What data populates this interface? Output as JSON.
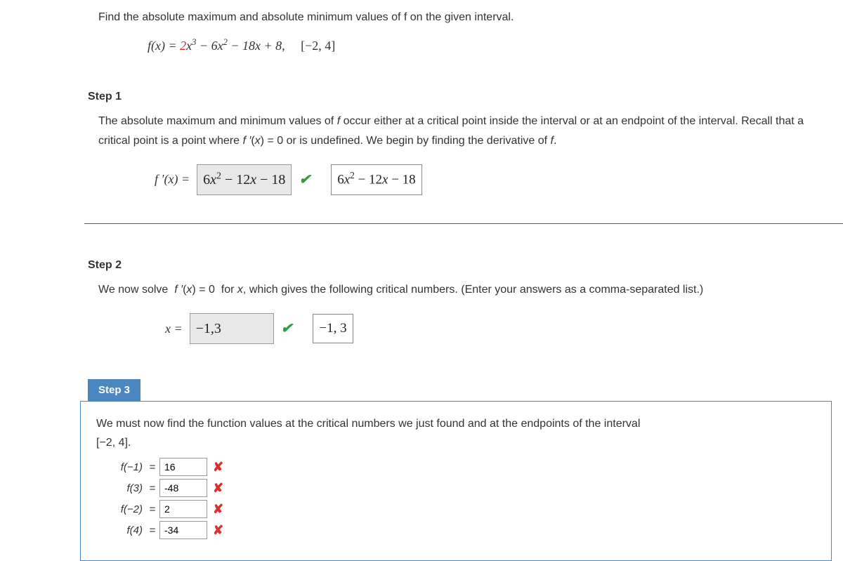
{
  "problem": {
    "prompt": "Find the absolute maximum and absolute minimum values of f on the given interval.",
    "func_lhs": "f(x) = ",
    "func_leading_coef": "2",
    "func_rest": "x³ − 6x² − 18x + 8,",
    "interval": "[−2, 4]"
  },
  "step1": {
    "title": "Step 1",
    "body": "The absolute maximum and minimum values of f occur either at a critical point inside the interval or at an endpoint of the interval. Recall that a critical point is a point where f ′(x) = 0 or is undefined. We begin by finding the derivative of f.",
    "eq_lhs": "f ′(x) = ",
    "answer": "6x² − 12x − 18",
    "hint": "6x² − 12x − 18"
  },
  "step2": {
    "title": "Step 2",
    "body": "We now solve  f ′(x) = 0  for x, which gives the following critical numbers. (Enter your answers as a comma-separated list.)",
    "eq_lhs": "x = ",
    "answer": "−1,3",
    "hint": "−1, 3"
  },
  "step3": {
    "title": "Step 3",
    "body_a": "We must now find the function values at the critical numbers we just found and at the endpoints of the interval ",
    "interval": "[−2, 4].",
    "rows": [
      {
        "lhs": "f(−1)",
        "val": "16"
      },
      {
        "lhs": "f(3)",
        "val": "-48"
      },
      {
        "lhs": "f(−2)",
        "val": "2"
      },
      {
        "lhs": "f(4)",
        "val": "-34"
      }
    ]
  },
  "icons": {
    "check": "✔",
    "wrong": "✘"
  }
}
